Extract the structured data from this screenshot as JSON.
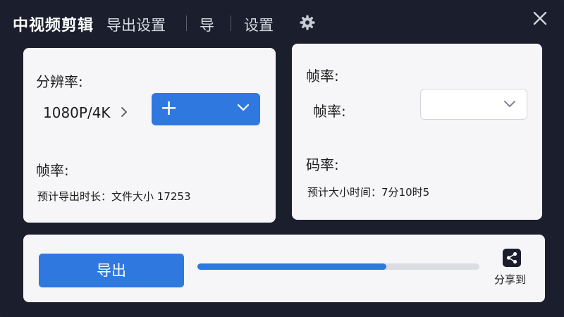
{
  "app": {
    "title": "中视频剪辑"
  },
  "nav": {
    "items": [
      "导出设置",
      "导",
      "设置"
    ]
  },
  "icons": {
    "settings": "gear-icon",
    "close": "close-icon",
    "share": "share-icon",
    "dropdown": "chevron-down-icon"
  },
  "left_panel": {
    "resolution_label": "分辨率:",
    "resolution_value": "1080P/4K",
    "resolution_dropdown_value": "+",
    "framerate_label": "帧率:",
    "estimate_text": "预计导出时长：文件大小 17253"
  },
  "right_panel": {
    "framerate_title": "帧率:",
    "framerate_label": "帧率:",
    "framerate_dropdown_value": "",
    "bitrate_label": "码率:",
    "estimate_text": "预计大小时间：7分10时5"
  },
  "bottom": {
    "export_label": "导出",
    "progress": 0.67,
    "share_label": "分享到"
  },
  "colors": {
    "accent": "#2f78e0",
    "background": "#1b1e2d",
    "card": "#f6f6f8"
  }
}
